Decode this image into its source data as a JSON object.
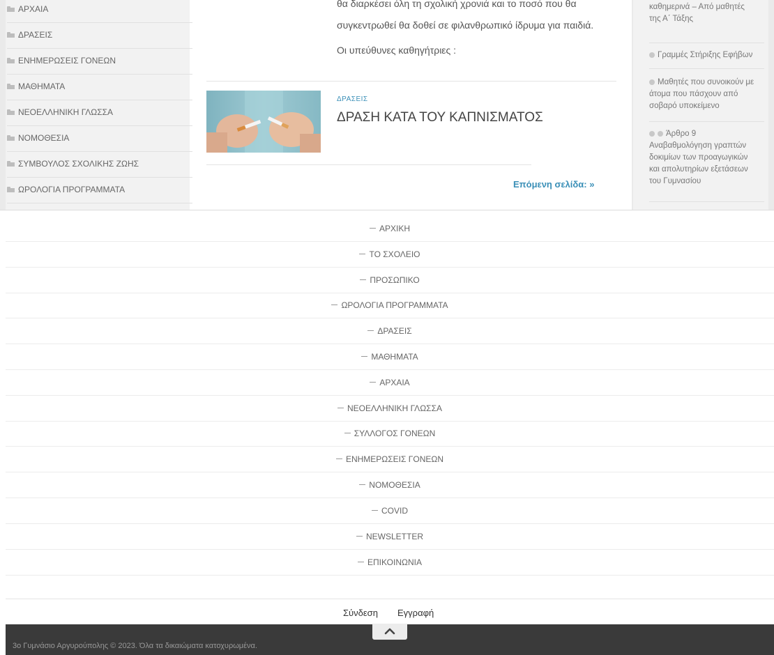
{
  "left_categories": [
    "ΑΡΧΑΙΑ",
    "ΔΡΑΣΕΙΣ",
    "ΕΝΗΜΕΡΩΣΕΙΣ ΓΟΝΕΩΝ",
    "ΜΑΘΗΜΑΤΑ",
    "ΝΕΟΕΛΛΗΝΙΚΗ ΓΛΩΣΣΑ",
    "ΝΟΜΟΘΕΣΙΑ",
    "ΣΥΜΒΟΥΛΟΣ ΣΧΟΛΙΚΗΣ ΖΩΗΣ",
    "ΩΡΟΛΟΓΙΑ ΠΡΟΓΡΑΜΜΑΤΑ"
  ],
  "main": {
    "text_line1": "θα διαρκέσει όλη τη σχολική χρονιά και το ποσό που θα",
    "text_line2": "συγκεντρωθεί θα δοθεί σε φιλανθρωπικό ίδρυμα για παιδιά.",
    "text_line3": "Οι υπεύθυνες καθηγήτριες :",
    "post": {
      "category": "ΔΡΑΣΕΙΣ",
      "title": "ΔΡΑΣΗ ΚΑΤΑ ΤΟΥ ΚΑΠΝΙΣΜΑΤΟΣ"
    },
    "next_page": "Επόμενη σελίδα: »"
  },
  "right_widget": {
    "item1_line1": "καθημερινά – Από μαθητές",
    "item1_line2": "της Α΄ Τάξης",
    "item2": "Γραμμές Στήριξης Εφήβων",
    "item3_line1": "Μαθητές που συνοικούν με",
    "item3_line2": "άτομα που πάσχουν από",
    "item3_line3": "σοβαρό υποκείμενο",
    "item4_line1": "Άρθρο 9",
    "item4_line2": "Αναβαθμολόγηση γραπτών",
    "item4_line3": "δοκιμίων των προαγωγικών",
    "item4_line4": "και απολυτηρίων εξετάσεων",
    "item4_line5": "του Γυμνασίου"
  },
  "footer_menu": [
    "ΑΡΧΙΚΗ",
    "ΤΟ ΣΧΟΛΕΙΟ",
    "ΠΡΟΣΩΠΙΚΟ",
    "ΩΡΟΛΟΓΙΑ ΠΡΟΓΡΑΜΜΑΤΑ",
    "ΔΡΑΣΕΙΣ",
    "ΜΑΘΗΜΑΤΑ",
    "ΑΡΧΑΙΑ",
    "ΝΕΟΕΛΛΗΝΙΚΗ ΓΛΩΣΣΑ",
    "ΣΥΛΛΟΓΟΣ ΓΟΝΕΩΝ",
    "ΕΝΗΜΕΡΩΣΕΙΣ ΓΟΝΕΩΝ",
    "ΝΟΜΟΘΕΣΙΑ",
    "COVID",
    "NEWSLETTER",
    "ΕΠΙΚΟΙΝΩΝΙΑ"
  ],
  "login": {
    "signin": "Σύνδεση",
    "register": "Εγγραφή"
  },
  "footer": {
    "copyright": "3ο Γυμνάσιο Αργυρούπολης © 2023. Όλα τα δικαιώματα κατοχυρωμένα."
  },
  "colors": {
    "link": "#3a8fb7",
    "dark_bar": "#3a3a3a"
  },
  "icons": {
    "category": "folder-icon",
    "back_to_top": "chevron-up-icon"
  }
}
